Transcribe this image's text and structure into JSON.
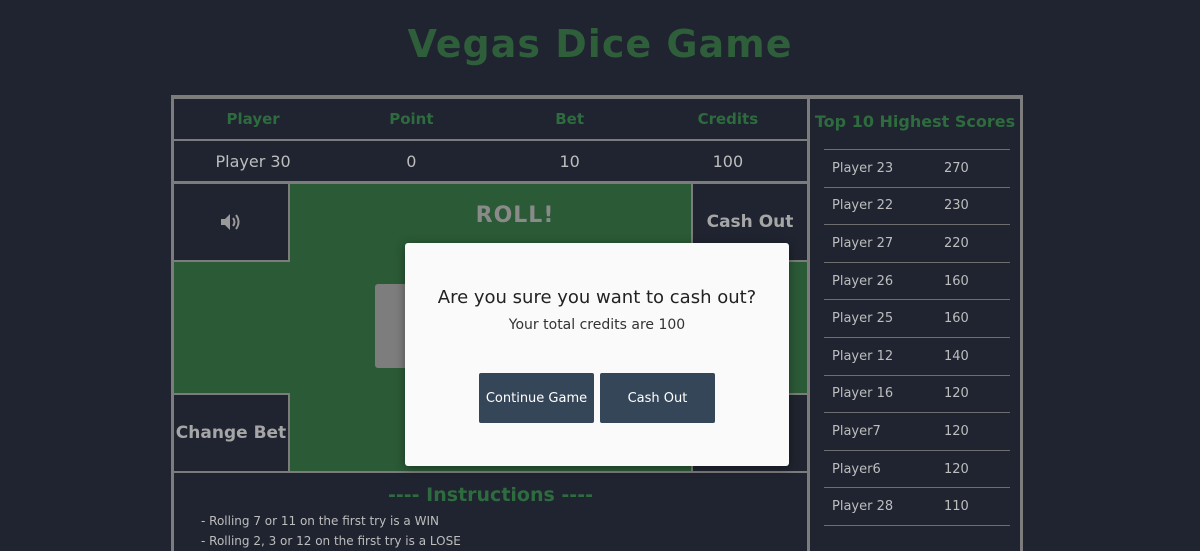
{
  "title": "Vegas Dice Game",
  "stats": {
    "headers": [
      "Player",
      "Point",
      "Bet",
      "Credits"
    ],
    "values": [
      "Player 30",
      "0",
      "10",
      "100"
    ]
  },
  "table": {
    "sound_icon": "speaker-icon",
    "roll_label": "ROLL!",
    "cash_out_label": "Cash Out",
    "change_bet_label": "Change Bet"
  },
  "instructions": {
    "heading": "---- Instructions ----",
    "lines": [
      "- Rolling 7 or 11 on the first try is a WIN",
      "- Rolling 2, 3 or 12 on the first try is a LOSE"
    ]
  },
  "scores": {
    "heading": "Top 10 Highest Scores",
    "entries": [
      {
        "name": "Player 23",
        "score": "270"
      },
      {
        "name": "Player 22",
        "score": "230"
      },
      {
        "name": "Player 27",
        "score": "220"
      },
      {
        "name": "Player 26",
        "score": "160"
      },
      {
        "name": "Player 25",
        "score": "160"
      },
      {
        "name": "Player 12",
        "score": "140"
      },
      {
        "name": "Player 16",
        "score": "120"
      },
      {
        "name": "Player7",
        "score": "120"
      },
      {
        "name": "Player6",
        "score": "120"
      },
      {
        "name": "Player 28",
        "score": "110"
      }
    ]
  },
  "modal": {
    "question": "Are you sure you want to cash out?",
    "credits_text": "Your total credits are 100",
    "continue_label": "Continue Game",
    "cash_out_label": "Cash Out"
  },
  "colors": {
    "background": "#1f2430",
    "felt": "#2b5a36",
    "accent_green": "#2e6b3e",
    "button": "#364659"
  }
}
